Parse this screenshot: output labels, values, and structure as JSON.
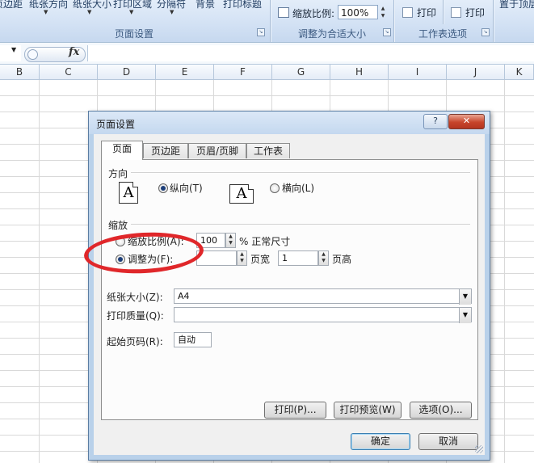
{
  "ribbon": {
    "top_labels": [
      "页边距",
      "纸张方向",
      "纸张大小",
      "打印区域",
      "分隔符",
      "背景",
      "打印标题"
    ],
    "group_page_setup": "页面设置",
    "group_scale": "调整为合适大小",
    "group_sheet_options": "工作表选项",
    "scale_label": "缩放比例:",
    "scale_value": "100%",
    "print_gridlines": "打印",
    "print_headings": "打印",
    "far_right_label": "置于顶层"
  },
  "formula_bar": {
    "fx": "fx"
  },
  "columns": [
    "B",
    "C",
    "D",
    "E",
    "F",
    "G",
    "H",
    "I",
    "J",
    "K"
  ],
  "dialog": {
    "title": "页面设置",
    "help": "?",
    "close": "✕",
    "tabs": [
      "页面",
      "页边距",
      "页眉/页脚",
      "工作表"
    ],
    "active_tab": "页面",
    "orientation": {
      "section": "方向",
      "portrait": "纵向(T)",
      "landscape": "横向(L)",
      "selected": "portrait",
      "glyph": "A"
    },
    "scaling": {
      "section": "缩放",
      "adjust_to_label": "缩放比例(A):",
      "adjust_value": "100",
      "adjust_suffix": "% 正常尺寸",
      "fit_to_label": "调整为(F):",
      "fit_wide_suffix": "页宽",
      "fit_tall_value": "1",
      "fit_tall_suffix": "页高",
      "selected": "fit_to"
    },
    "paper_size_label": "纸张大小(Z):",
    "paper_size_value": "A4",
    "print_quality_label": "打印质量(Q):",
    "print_quality_value": "",
    "first_page_label": "起始页码(R):",
    "first_page_value": "自动",
    "buttons": {
      "print": "打印(P)...",
      "preview": "打印预览(W)",
      "options": "选项(O)...",
      "ok": "确定",
      "cancel": "取消"
    }
  },
  "annotation_color": "#e0272a"
}
